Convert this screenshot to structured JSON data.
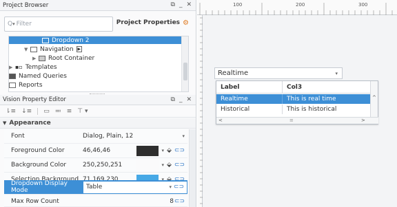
{
  "project_browser": {
    "title": "Project Browser",
    "filter_placeholder": "Filter",
    "project_properties_label": "Project Properties",
    "tree": [
      {
        "label": "Dropdown 2"
      },
      {
        "label": "Navigation"
      },
      {
        "label": "Root Container"
      },
      {
        "label": "Templates"
      },
      {
        "label": "Named Queries"
      },
      {
        "label": "Reports"
      }
    ]
  },
  "vision_property_editor": {
    "title": "Vision Property Editor",
    "section": "Appearance",
    "properties": [
      {
        "label": "Font",
        "value": "Dialog, Plain, 12",
        "color": null
      },
      {
        "label": "Foreground Color",
        "value": "46,46,46",
        "color": "#2e2e2e"
      },
      {
        "label": "Background Color",
        "value": "250,250,251",
        "color": "#fafafb"
      },
      {
        "label": "Selection Background",
        "value": "71,169,230",
        "color": "#47a9e6"
      },
      {
        "label": "Dropdown Display Mode",
        "value": "Table",
        "color": null
      },
      {
        "label": "Max Row Count",
        "value": "8",
        "color": null
      }
    ]
  },
  "designer": {
    "ruler_labels": [
      "100",
      "200",
      "300"
    ],
    "dropdown_value": "Realtime",
    "popup": {
      "columns": [
        "Label",
        "Col3"
      ],
      "rows": [
        [
          "Realtime",
          "This is real time"
        ],
        [
          "Historical",
          "This is historical"
        ]
      ]
    }
  },
  "colors": {
    "accent": "#3d8fd6",
    "link": "#2c76c5",
    "orange": "#e07b22"
  }
}
